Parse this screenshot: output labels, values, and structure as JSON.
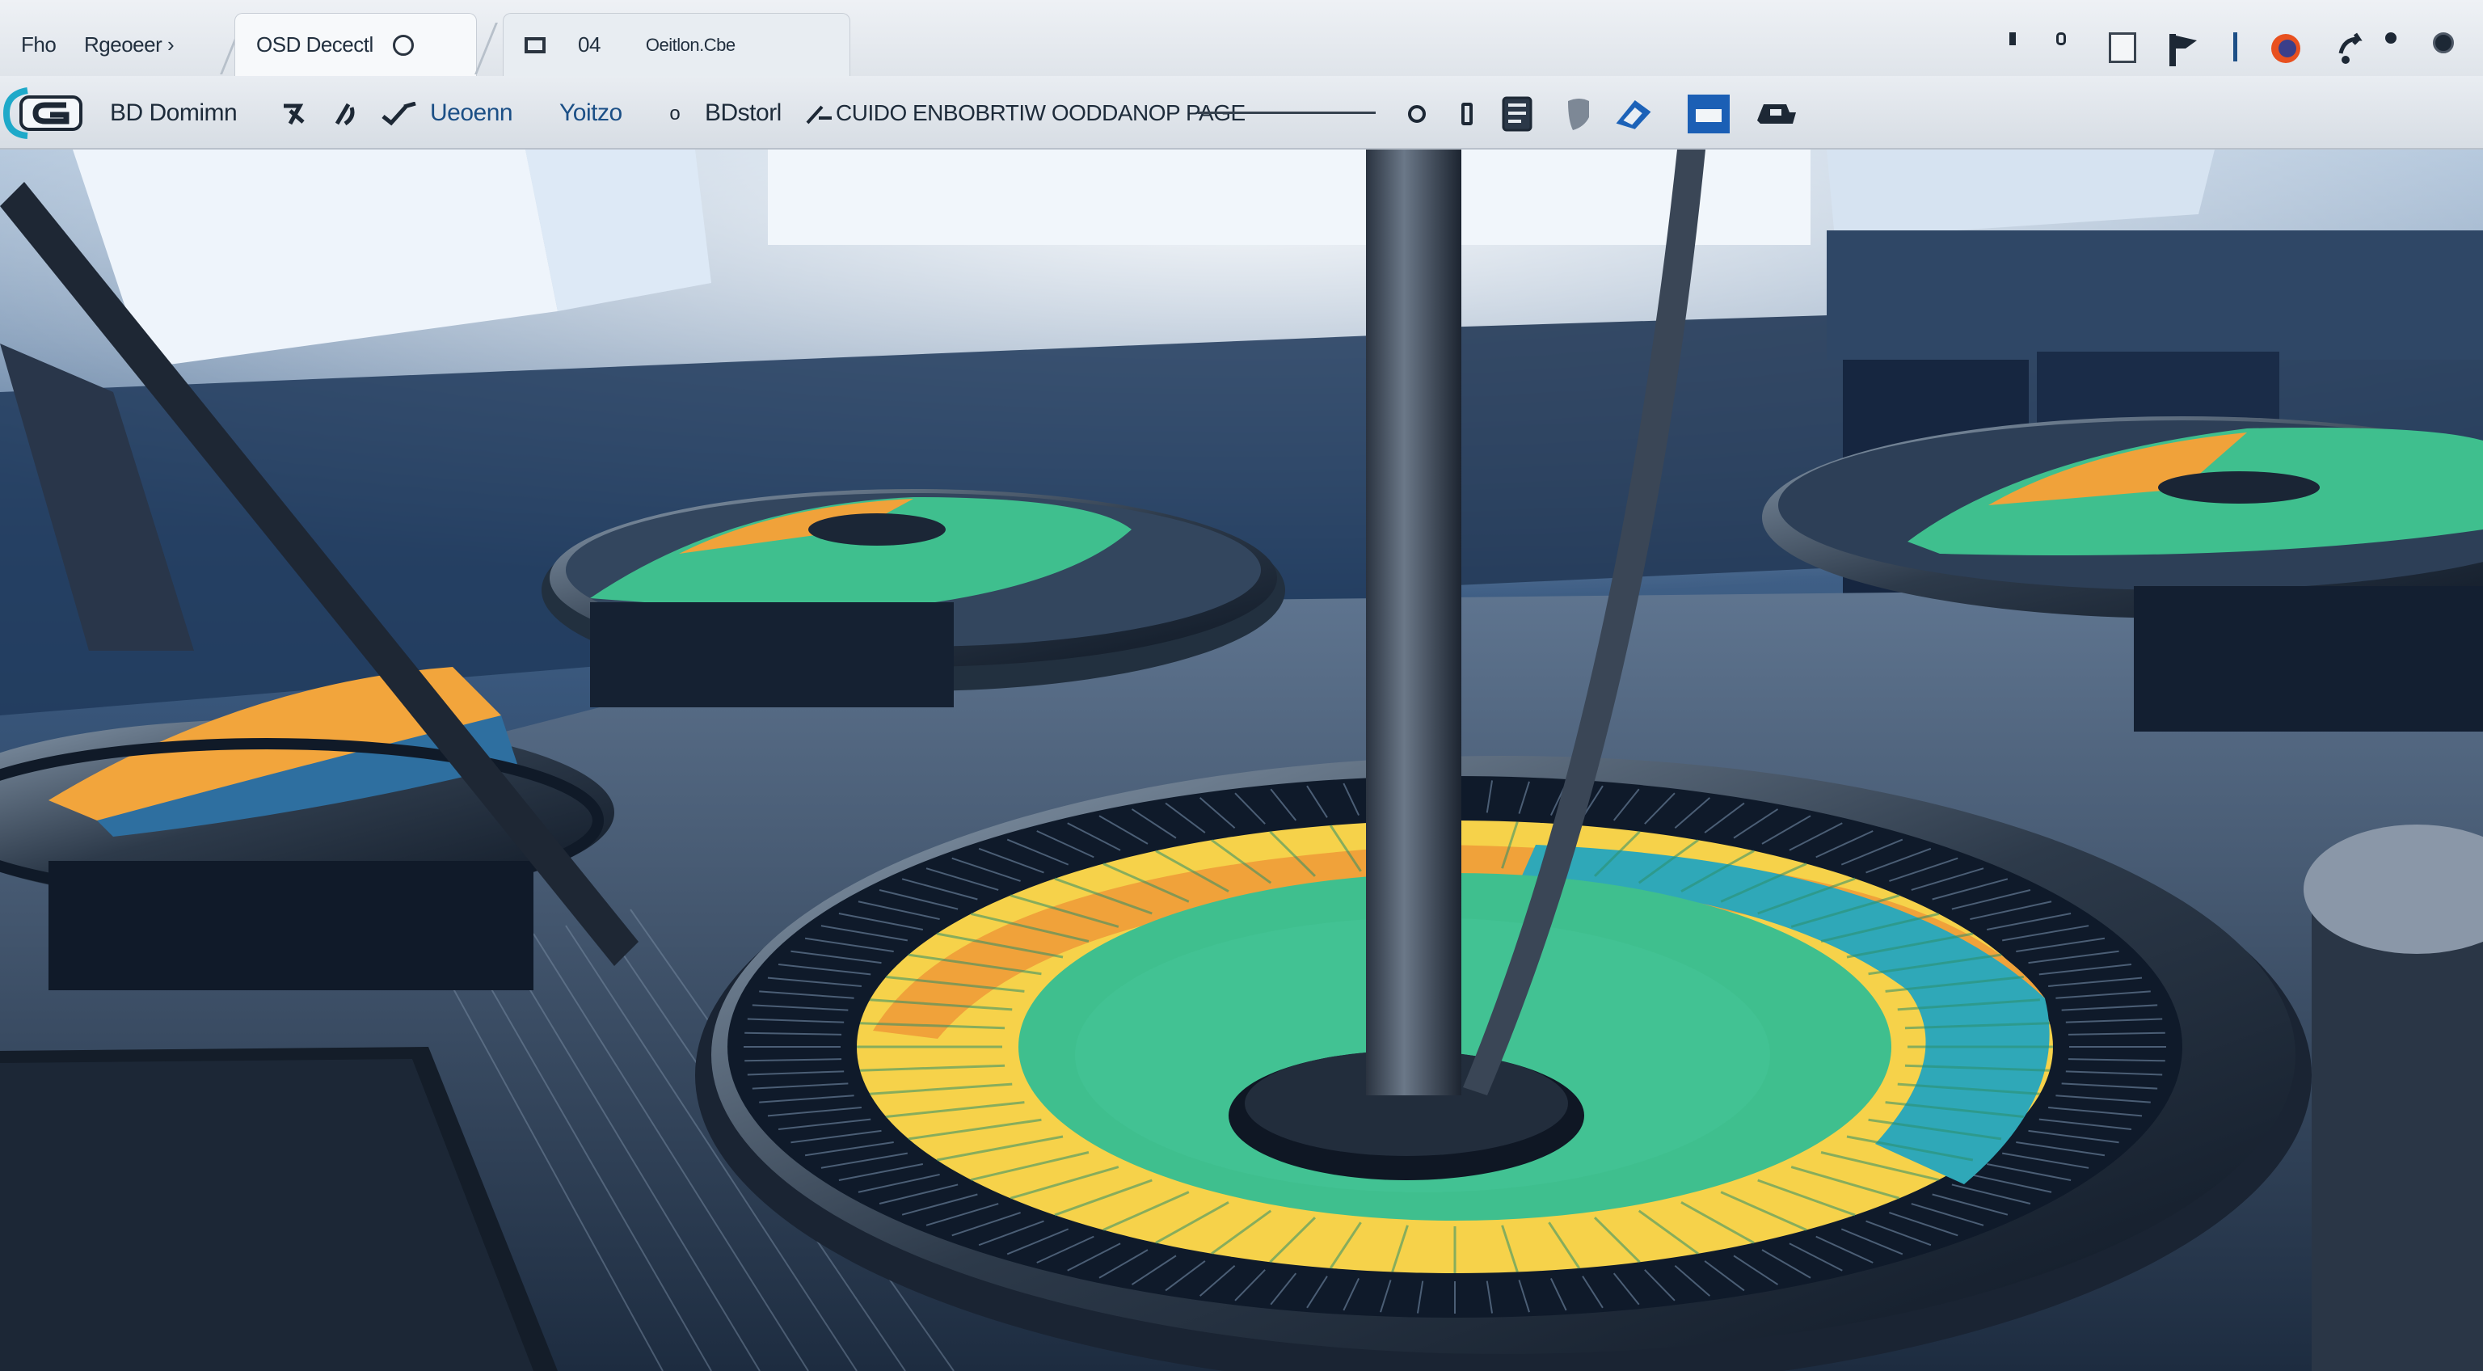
{
  "tabs": [
    {
      "label": "Fho"
    },
    {
      "label": "Rgeoeer ›"
    },
    {
      "label": "OSD Decectl"
    },
    {
      "label": "04"
    },
    {
      "label": "Oeitlon.Cbe"
    }
  ],
  "toolbar": {
    "item1": "BD Domimn",
    "item2": "Ueoenn",
    "item3": "Yoitzo",
    "item4": "BDstorl",
    "item5": "CUIDO  ENBOBRTIW OODDANOP PAGE"
  },
  "colors": {
    "accent": "#1ea9c9",
    "chrome": "#e4e8ed",
    "dial_green": "#3fbf8e",
    "dial_orange": "#f0a23a",
    "dial_yellow": "#f6d24a",
    "save_blue": "#1b5fb5"
  },
  "icons": [
    "app-logo-icon",
    "hook-icon",
    "plug-icon",
    "check-icon",
    "circle-icon",
    "phone-icon",
    "document-icon",
    "shield-icon",
    "edit-icon",
    "save-icon",
    "ship-icon",
    "square-icon",
    "flag-icon",
    "firefox-icon",
    "share-icon",
    "record-icon",
    "close-icon"
  ]
}
